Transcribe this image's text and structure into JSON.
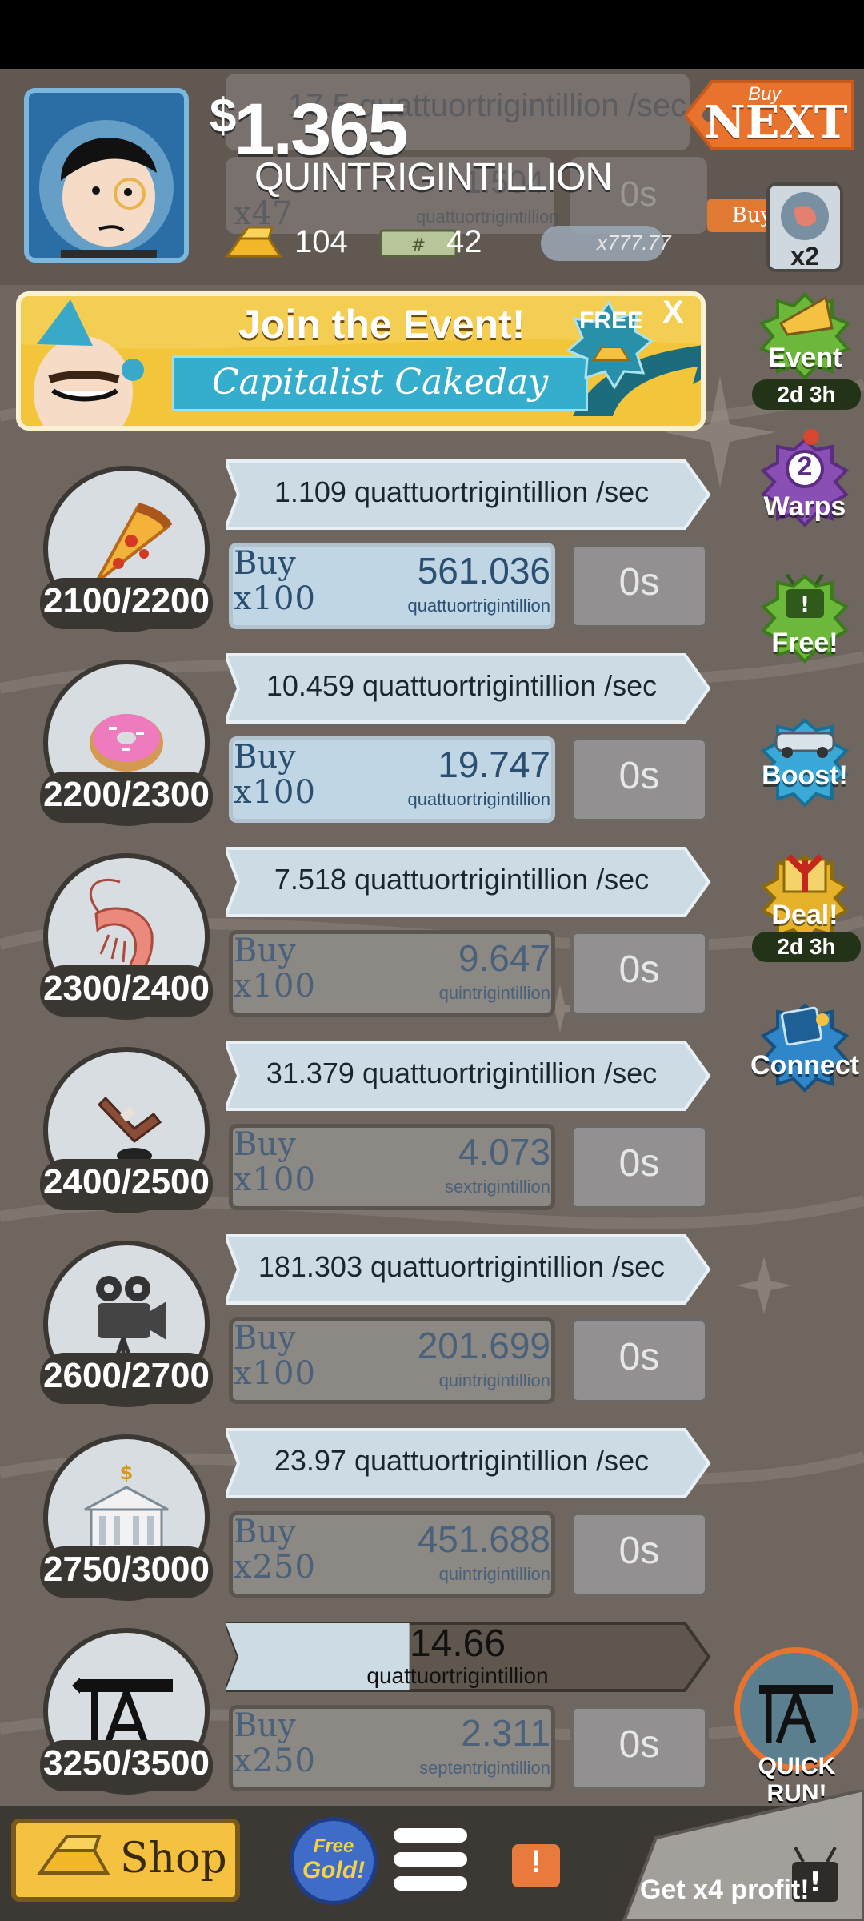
{
  "header": {
    "money_symbol": "$",
    "money_amount": "1.365",
    "money_unit": "QUINTRIGINTILLION",
    "gold_count": "104",
    "megabucks_count": "42",
    "multiplier_bill_text": "x777.77",
    "buy_next_small": "Buy",
    "buy_next_big": "NEXT",
    "buy_small_label": "Buy",
    "multiplier_text": "x2",
    "ghost_rate": "17.5 quattuortrigintillion /sec",
    "ghost_price": "1.504",
    "ghost_price_unit": "quattuortrigintillion",
    "ghost_buy_line2": "x47",
    "ghost_timer": "0s"
  },
  "event_banner": {
    "title": "Join the Event!",
    "subtitle": "Capitalist Cakeday",
    "free_label": "FREE",
    "close_label": "X"
  },
  "businesses": [
    {
      "icon": "pizza-icon",
      "count": "2100/2200",
      "rate": "1.109 quattuortrigintillion /sec",
      "buy_line1": "Buy",
      "buy_line2": "x100",
      "price": "561.036",
      "price_unit": "quattuortrigintillion",
      "timer": "0s",
      "affordable": true
    },
    {
      "icon": "donut-icon",
      "count": "2200/2300",
      "rate": "10.459 quattuortrigintillion /sec",
      "buy_line1": "Buy",
      "buy_line2": "x100",
      "price": "19.747",
      "price_unit": "quattuortrigintillion",
      "timer": "0s",
      "affordable": true
    },
    {
      "icon": "shrimp-icon",
      "count": "2300/2400",
      "rate": "7.518 quattuortrigintillion /sec",
      "buy_line1": "Buy",
      "buy_line2": "x100",
      "price": "9.647",
      "price_unit": "quintrigintillion",
      "timer": "0s",
      "affordable": false
    },
    {
      "icon": "hockey-icon",
      "count": "2400/2500",
      "rate": "31.379 quattuortrigintillion /sec",
      "buy_line1": "Buy",
      "buy_line2": "x100",
      "price": "4.073",
      "price_unit": "sextrigintillion",
      "timer": "0s",
      "affordable": false
    },
    {
      "icon": "movie-camera-icon",
      "count": "2600/2700",
      "rate": "181.303 quattuortrigintillion /sec",
      "buy_line1": "Buy",
      "buy_line2": "x100",
      "price": "201.699",
      "price_unit": "quintrigintillion",
      "timer": "0s",
      "affordable": false
    },
    {
      "icon": "bank-icon",
      "count": "2750/3000",
      "rate": "23.97 quattuortrigintillion /sec",
      "buy_line1": "Buy",
      "buy_line2": "x250",
      "price": "451.688",
      "price_unit": "quintrigintillion",
      "timer": "0s",
      "affordable": false
    },
    {
      "icon": "oil-rig-icon",
      "count": "3250/3500",
      "progress_value": "14.66",
      "progress_unit": "quattuortrigintillion",
      "progress_fraction": 0.4,
      "buy_line1": "Buy",
      "buy_line2": "x250",
      "price": "2.311",
      "price_unit": "septentrigintillion",
      "timer": "0s",
      "affordable": false
    }
  ],
  "side_menu": {
    "event_label": "Event",
    "event_timer": "2d 3h",
    "warps_count": "2",
    "warps_label": "Warps",
    "free_label": "Free!",
    "boost_label": "Boost!",
    "deal_label": "Deal!",
    "deal_timer": "2d 3h",
    "connect_label": "Connect"
  },
  "quick_run": {
    "label": "QUICK RUN!"
  },
  "bottom_bar": {
    "shop_label": "Shop",
    "free_gold_line1": "Free",
    "free_gold_line2": "Gold!",
    "alert_mark": "!",
    "x4_label": "Get x4 profit!"
  },
  "colors": {
    "background": "#6f6660",
    "accent_orange": "#e7732e",
    "affordable_button": "#c0d6e4",
    "unaffordable_button": "#8c8883",
    "event_green": "#6cb83a",
    "warps_purple": "#8a4fb4",
    "boost_blue": "#3aa9d8",
    "deal_gold": "#e5b22a",
    "connect_blue": "#2f86c8"
  }
}
